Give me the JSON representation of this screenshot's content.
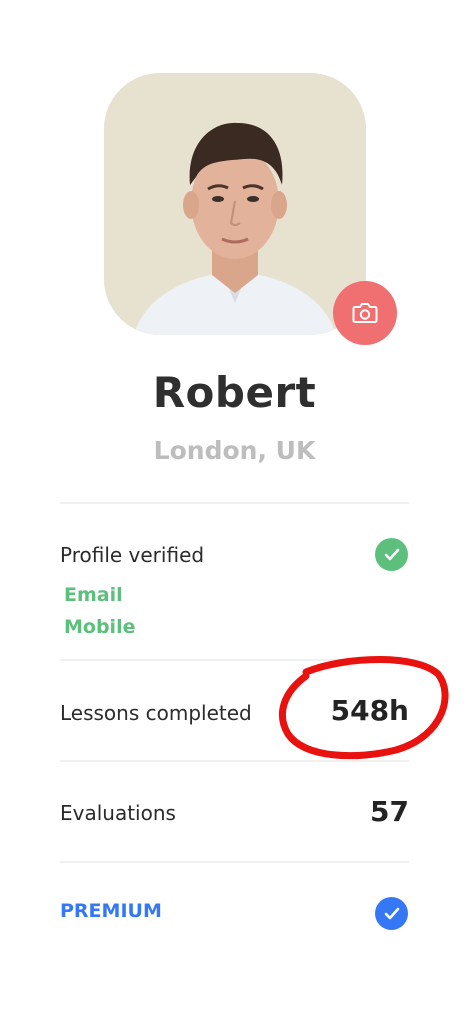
{
  "profile": {
    "name": "Robert",
    "location": "London, UK"
  },
  "rows": {
    "verified": {
      "label": "Profile verified",
      "items": [
        "Email",
        "Mobile"
      ]
    },
    "lessons": {
      "label": "Lessons completed",
      "value": "548h"
    },
    "evaluations": {
      "label": "Evaluations",
      "value": "57"
    },
    "premium": {
      "label": "PREMIUM"
    }
  },
  "icons": {
    "camera": "camera-icon",
    "verified_check": "check-icon",
    "premium_check": "check-icon"
  },
  "colors": {
    "camera_button": "#f06f71",
    "verified": "#5cc07c",
    "premium": "#3478f6",
    "annotation": "#e8130f"
  }
}
